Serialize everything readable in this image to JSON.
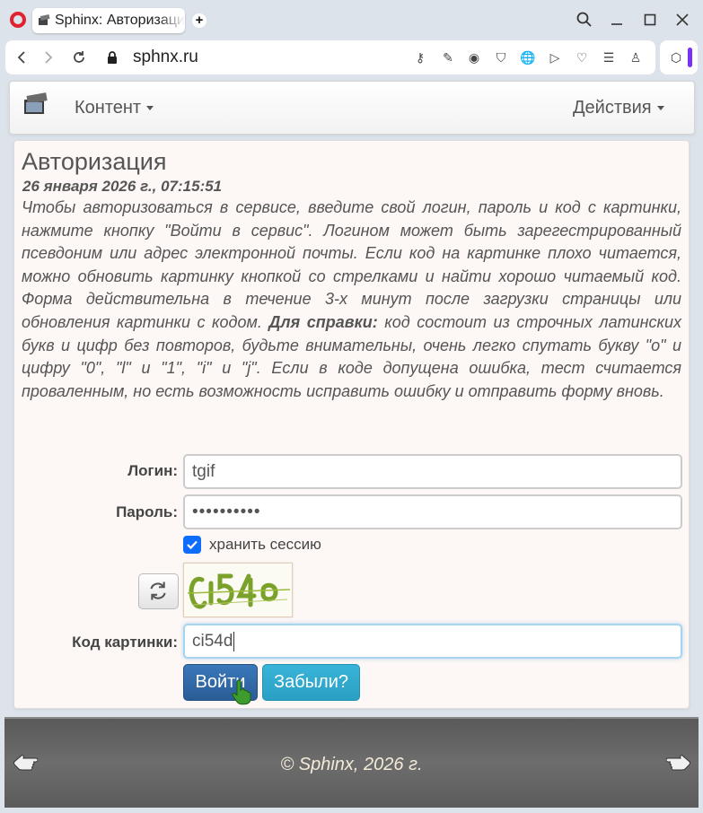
{
  "browser": {
    "tab_title": "Sphinx: Авторизация",
    "url": "sphnx.ru",
    "accent_logo": "#e0232e",
    "icons": [
      "back-icon",
      "forward-icon",
      "reload-icon",
      "lock-icon",
      "key-icon",
      "edit-icon",
      "camera-icon",
      "shield-icon",
      "translate-icon",
      "send-icon",
      "heart-icon",
      "menu-icon",
      "profile-icon",
      "cube-icon",
      "search-icon",
      "minimize-icon",
      "maximize-icon",
      "close-icon"
    ]
  },
  "navbar": {
    "content_menu": "Контент",
    "actions_menu": "Действия"
  },
  "auth": {
    "title": "Авторизация",
    "date": "26 января 2026 г., 07:15:51",
    "intro_part1": "Чтобы авторизоваться в сервисе, введите свой логин, пароль и код с картинки, нажмите кнопку \"Войти в сервис\". Логином может быть зарегестрированный псевдоним или адрес электронной почты. Если код на картинке плохо читается, можно обновить картинку кнопкой со стрелками и найти хорошо читаемый код. Форма действительна в течение 3-х минут после загрузки страницы или обновления картинки с кодом.",
    "intro_bold": "Для справки:",
    "intro_part2": "код состоит из строчных латинских букв и цифр без повторов, будьте внимательны, очень легко спутать букву \"о\" и цифру \"0\", \"l\" и \"1\", \"i\" и \"j\". Если в коде допущена ошибка, тест считается проваленным, но есть возможность исправить ошибку и отправить форму вновь.",
    "login_label": "Логин:",
    "login_value": "tgif",
    "password_label": "Пароль:",
    "password_value": "••••••••••",
    "remember_label": "хранить сессию",
    "remember_checked": true,
    "captcha_label": "Код картинки:",
    "captcha_value": "ci54d",
    "submit_label": "Войти",
    "forgot_label": "Забыли?"
  },
  "footer": {
    "copyright": "© Sphinx, 2026 г."
  }
}
